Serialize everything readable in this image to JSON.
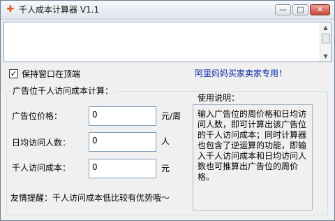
{
  "window": {
    "title": "千人成本计算器 V1.1",
    "icon": "app-icon",
    "controls": {
      "minimize": "—",
      "maximize": "□",
      "close": "✕"
    }
  },
  "options": {
    "stay_on_top_checked": true,
    "stay_on_top_label": "保持窗口在顶端",
    "promo_link": "阿里妈妈买家卖家专用！"
  },
  "calculator": {
    "group_title": "广告位千人访问成本计算：",
    "fields": [
      {
        "label": "广告位价格：",
        "value": "0",
        "unit": "元/周"
      },
      {
        "label": "日均访问人数：",
        "value": "0",
        "unit": "人"
      },
      {
        "label": "千人访问成本：",
        "value": "0",
        "unit": "元"
      }
    ],
    "tip": "友情提醒：千人访问成本低比较有优势哦～"
  },
  "help": {
    "title": "使用说明：",
    "text": "输入广告位的周价格和日均访问人数，即可计算出该广告位的千人访问成本；同时计算器也包含了逆运算的功能，即输入千人访问成本和日均访问人数也可推算出广告位的周价格。"
  }
}
